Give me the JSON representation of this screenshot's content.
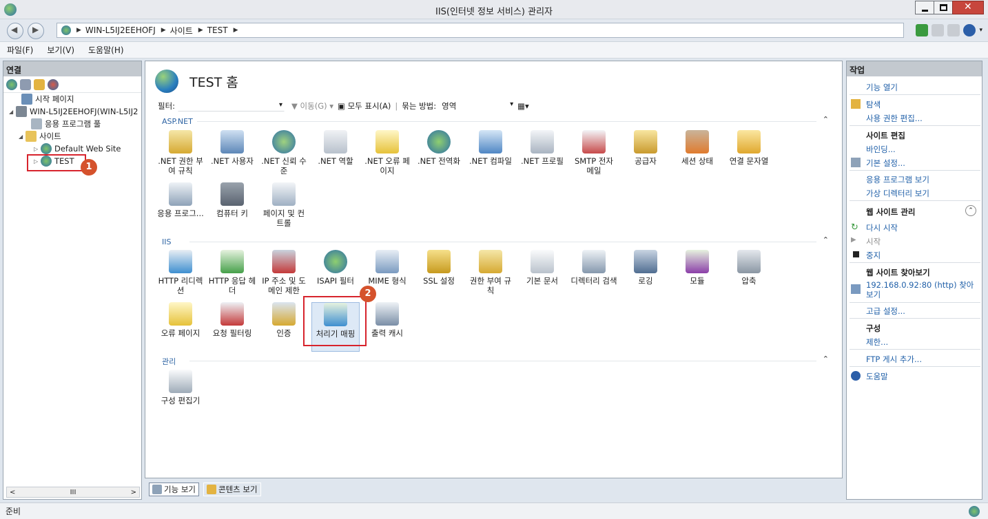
{
  "window": {
    "title": "IIS(인터넷 정보 서비스) 관리자"
  },
  "address": {
    "crumbs": [
      "WIN-L5IJ2EEHOFJ",
      "사이트",
      "TEST"
    ]
  },
  "menu": [
    "파일(F)",
    "보기(V)",
    "도움말(H)"
  ],
  "connections": {
    "header": "연결",
    "tree": [
      {
        "label": "시작 페이지"
      },
      {
        "label": "WIN-L5IJ2EEHOFJ(WIN-L5IJ2"
      },
      {
        "label": "응용 프로그램 풀"
      },
      {
        "label": "사이트"
      },
      {
        "label": "Default Web Site"
      },
      {
        "label": "TEST"
      }
    ],
    "scroll_mid": "III"
  },
  "center": {
    "title": "TEST 홈",
    "filter": {
      "label": "필터:",
      "go": "이동(G)",
      "show_all": "모두 표시(A)",
      "group_by": "묶는 방법:",
      "group_value": "영역"
    },
    "sections": [
      "ASP.NET",
      "IIS",
      "관리"
    ],
    "aspnet": [
      ".NET 권한 부여 규칙",
      ".NET 사용자",
      ".NET 신뢰 수준",
      ".NET 역할",
      ".NET 오류 페이지",
      ".NET 전역화",
      ".NET 컴파일",
      ".NET 프로필",
      "SMTP 전자 메일",
      "공급자",
      "세션 상태",
      "연결 문자열",
      "응용 프로그...",
      "컴퓨터 키",
      "페이지 및 컨트롤"
    ],
    "iis": [
      "HTTP 리디렉션",
      "HTTP 응답 헤더",
      "IP 주소 및 도메인 제한",
      "ISAPI 필터",
      "MIME 형식",
      "SSL 설정",
      "권한 부여 규칙",
      "기본 문서",
      "디렉터리 검색",
      "로깅",
      "모듈",
      "압축",
      "오류 페이지",
      "요청 필터링",
      "인증",
      "처리기 매핑",
      "출력 캐시"
    ],
    "mgmt": [
      "구성 편집기"
    ],
    "views": {
      "features": "기능 보기",
      "content": "콘텐츠 보기"
    },
    "badges": [
      "1",
      "2"
    ]
  },
  "actions": {
    "header": "작업",
    "open_feature": "기능 열기",
    "explore": "탐색",
    "edit_perm": "사용 권한 편집...",
    "site_edit": "사이트 편집",
    "bindings": "바인딩...",
    "basic": "기본 설정...",
    "view_apps": "응용 프로그램 보기",
    "view_vdirs": "가상 디렉터리 보기",
    "manage": "웹 사이트 관리",
    "restart": "다시 시작",
    "start": "시작",
    "stop": "중지",
    "browse": "웹 사이트 찾아보기",
    "browse_link": "192.168.0.92:80 (http) 찾아보기",
    "advanced": "고급 설정...",
    "config": "구성",
    "limits": "제한...",
    "ftp": "FTP 게시 추가...",
    "help": "도움말"
  },
  "status": {
    "text": "준비"
  }
}
